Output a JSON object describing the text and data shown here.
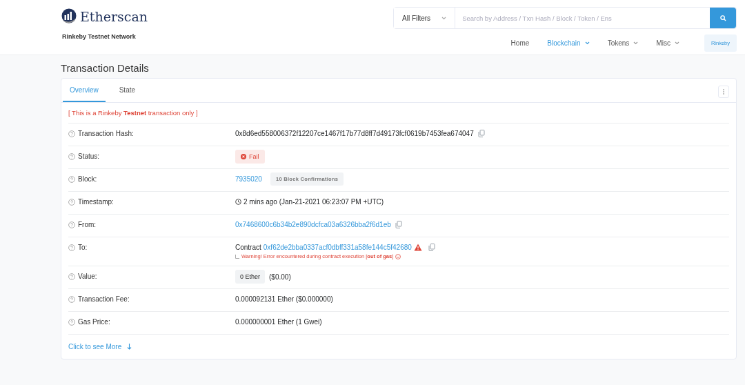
{
  "header": {
    "brand": "Etherscan",
    "network": "Rinkeby Testnet Network",
    "filter": "All Filters",
    "search": {
      "placeholder": "Search by Address / Txn Hash / Block / Token / Ens"
    },
    "nav": [
      {
        "label": "Home",
        "selected": false,
        "dropdown": false
      },
      {
        "label": "Blockchain",
        "selected": true,
        "dropdown": true
      },
      {
        "label": "Tokens",
        "selected": false,
        "dropdown": true
      },
      {
        "label": "Misc",
        "selected": false,
        "dropdown": true
      }
    ],
    "network_button": "Rinkeby"
  },
  "page_title": "Transaction Details",
  "tabs": [
    {
      "label": "Overview",
      "selected": true
    },
    {
      "label": "State",
      "selected": false
    }
  ],
  "notice": "[ This is a Rinkeby **Testnet** transaction only ]",
  "rows": [
    {
      "kind": "copy",
      "label": "Transaction Hash:",
      "value": "0x8d6ed558006372f12207ce1467f17b77d8ff7d49173fcf0619b7453fea674047",
      "link": false
    },
    {
      "kind": "status",
      "label": "Status:",
      "value": "Fail"
    },
    {
      "kind": "block",
      "label": "Block:",
      "value": "7935020",
      "badge": "10 Block Confirmations"
    },
    {
      "kind": "time",
      "label": "Timestamp:",
      "value": "2 mins ago (Jan-21-2021 06:23:07 PM +UTC)"
    },
    {
      "kind": "copy",
      "label": "From:",
      "value": "0x7468600c6b34b2e890dcfca03a6326bba2f6d1eb",
      "link": true
    },
    {
      "kind": "contract",
      "label": "To:",
      "prefix": "Contract",
      "value": "0xf62de2bba0337acf0dbff331a58fe144c5f42680",
      "warning": "Warning! Error encountered during contract execution [**out of gas**]"
    },
    {
      "kind": "amount",
      "label": "Value:",
      "badge": "0 Ether",
      "value": "($0.00)"
    },
    {
      "kind": "text",
      "label": "Transaction Fee:",
      "value": "0.000092131 Ether ($0.000000)"
    },
    {
      "kind": "text",
      "label": "Gas Price:",
      "value": "0.000000001 Ether (1 Gwei)"
    }
  ],
  "more_link": "Click to see More"
}
